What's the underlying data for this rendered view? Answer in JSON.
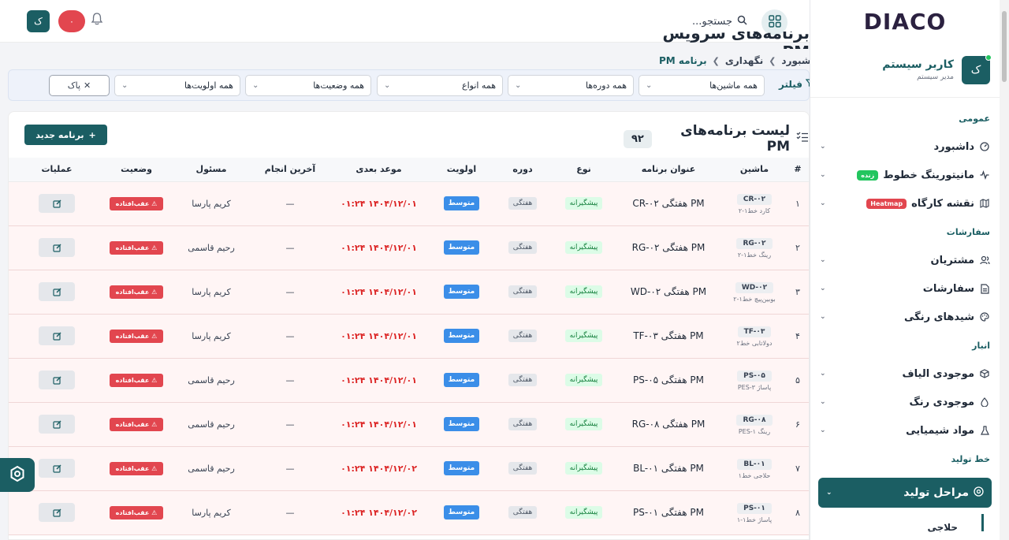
{
  "sidebar": {
    "logo": "DIACO",
    "user": {
      "avatar": "ک",
      "name": "کاربر سیستم",
      "role": "مدیر سیستم"
    },
    "sections": [
      {
        "title": "عمومی",
        "items": [
          {
            "label": "داشبورد",
            "icon": "gauge-icon"
          },
          {
            "label": "مانیتورینگ خطوط",
            "icon": "activity-icon",
            "badge": "زنده",
            "badge_color": "#22c55e"
          },
          {
            "label": "نقشه کارگاه",
            "icon": "map-icon",
            "badge": "Heatmap",
            "badge_color": "#e2464f"
          }
        ]
      },
      {
        "title": "سفارشات",
        "items": [
          {
            "label": "مشتریان",
            "icon": "users-icon"
          },
          {
            "label": "سفارشات",
            "icon": "file-icon"
          },
          {
            "label": "شیدهای رنگی",
            "icon": "palette-icon"
          }
        ]
      },
      {
        "title": "انبار",
        "items": [
          {
            "label": "موجودی الیاف",
            "icon": "box-icon"
          },
          {
            "label": "موجودی رنگ",
            "icon": "drop-icon"
          },
          {
            "label": "مواد شیمیایی",
            "icon": "flask-icon"
          }
        ]
      }
    ],
    "production_title": "خط تولید",
    "active_item": "مراحل تولید",
    "sub_item": "حلاجی"
  },
  "header": {
    "avatar": "ک",
    "notif_count": "۰",
    "search_placeholder": "جستجو..."
  },
  "page": {
    "title": "برنامه‌های سرویس PM",
    "breadcrumb": [
      "داشبورد",
      "نگهداری",
      "برنامه PM"
    ]
  },
  "filters": {
    "label": "فیلتر",
    "machines": "همه ماشین‌ها",
    "periods": "همه دوره‌ها",
    "types": "همه انواع",
    "statuses": "همه وضعیت‌ها",
    "priorities": "همه اولویت‌ها",
    "clear": "پاک"
  },
  "list": {
    "title": "لیست برنامه‌های PM",
    "count": "۹۲",
    "new_button": "برنامه جدید",
    "columns": [
      "#",
      "ماشین",
      "عنوان برنامه",
      "نوع",
      "دوره",
      "اولویت",
      "موعد بعدی",
      "آخرین انجام",
      "مسئول",
      "وضعیت",
      "عملیات"
    ],
    "rows": [
      {
        "num": "۱",
        "code": "CR-۰۲",
        "machine": "کارد خط۱-۲",
        "title": "PM هفتگی CR-۰۲",
        "type": "پیشگیرانه",
        "period": "هفتگی",
        "priority": "متوسط",
        "due": "۱۴۰۴/۱۲/۰۱ ۰۱:۲۴",
        "last": "—",
        "owner": "کریم پارسا",
        "status": "⚠ عقب‌افتاده"
      },
      {
        "num": "۲",
        "code": "RG-۰۲",
        "machine": "رینگ خط۱-۲",
        "title": "PM هفتگی RG-۰۲",
        "type": "پیشگیرانه",
        "period": "هفتگی",
        "priority": "متوسط",
        "due": "۱۴۰۴/۱۲/۰۱ ۰۱:۲۴",
        "last": "—",
        "owner": "رحیم قاسمی",
        "status": "⚠ عقب‌افتاده"
      },
      {
        "num": "۳",
        "code": "WD-۰۲",
        "machine": "بوبین‌پیچ خط۱-۲",
        "title": "PM هفتگی WD-۰۲",
        "type": "پیشگیرانه",
        "period": "هفتگی",
        "priority": "متوسط",
        "due": "۱۴۰۴/۱۲/۰۱ ۰۱:۲۴",
        "last": "—",
        "owner": "کریم پارسا",
        "status": "⚠ عقب‌افتاده"
      },
      {
        "num": "۴",
        "code": "TF-۰۳",
        "machine": "دولاتابی خط۲",
        "title": "PM هفتگی TF-۰۳",
        "type": "پیشگیرانه",
        "period": "هفتگی",
        "priority": "متوسط",
        "due": "۱۴۰۴/۱۲/۰۱ ۰۱:۲۴",
        "last": "—",
        "owner": "کریم پارسا",
        "status": "⚠ عقب‌افتاده"
      },
      {
        "num": "۵",
        "code": "PS-۰۵",
        "machine": "پاساژ PES-۳",
        "title": "PM هفتگی PS-۰۵",
        "type": "پیشگیرانه",
        "period": "هفتگی",
        "priority": "متوسط",
        "due": "۱۴۰۴/۱۲/۰۱ ۰۱:۲۴",
        "last": "—",
        "owner": "رحیم قاسمی",
        "status": "⚠ عقب‌افتاده"
      },
      {
        "num": "۶",
        "code": "RG-۰۸",
        "machine": "رینگ PES-۱",
        "title": "PM هفتگی RG-۰۸",
        "type": "پیشگیرانه",
        "period": "هفتگی",
        "priority": "متوسط",
        "due": "۱۴۰۴/۱۲/۰۱ ۰۱:۲۴",
        "last": "—",
        "owner": "رحیم قاسمی",
        "status": "⚠ عقب‌افتاده"
      },
      {
        "num": "۷",
        "code": "BL-۰۱",
        "machine": "حلاجی خط۱",
        "title": "PM هفتگی BL-۰۱",
        "type": "پیشگیرانه",
        "period": "هفتگی",
        "priority": "متوسط",
        "due": "۱۴۰۴/۱۲/۰۲ ۰۱:۲۴",
        "last": "—",
        "owner": "رحیم قاسمی",
        "status": "⚠ عقب‌افتاده"
      },
      {
        "num": "۸",
        "code": "PS-۰۱",
        "machine": "پاساژ خط۱-۱",
        "title": "PM هفتگی PS-۰۱",
        "type": "پیشگیرانه",
        "period": "هفتگی",
        "priority": "متوسط",
        "due": "۱۴۰۴/۱۲/۰۲ ۰۱:۲۴",
        "last": "—",
        "owner": "کریم پارسا",
        "status": "⚠ عقب‌افتاده"
      }
    ]
  }
}
